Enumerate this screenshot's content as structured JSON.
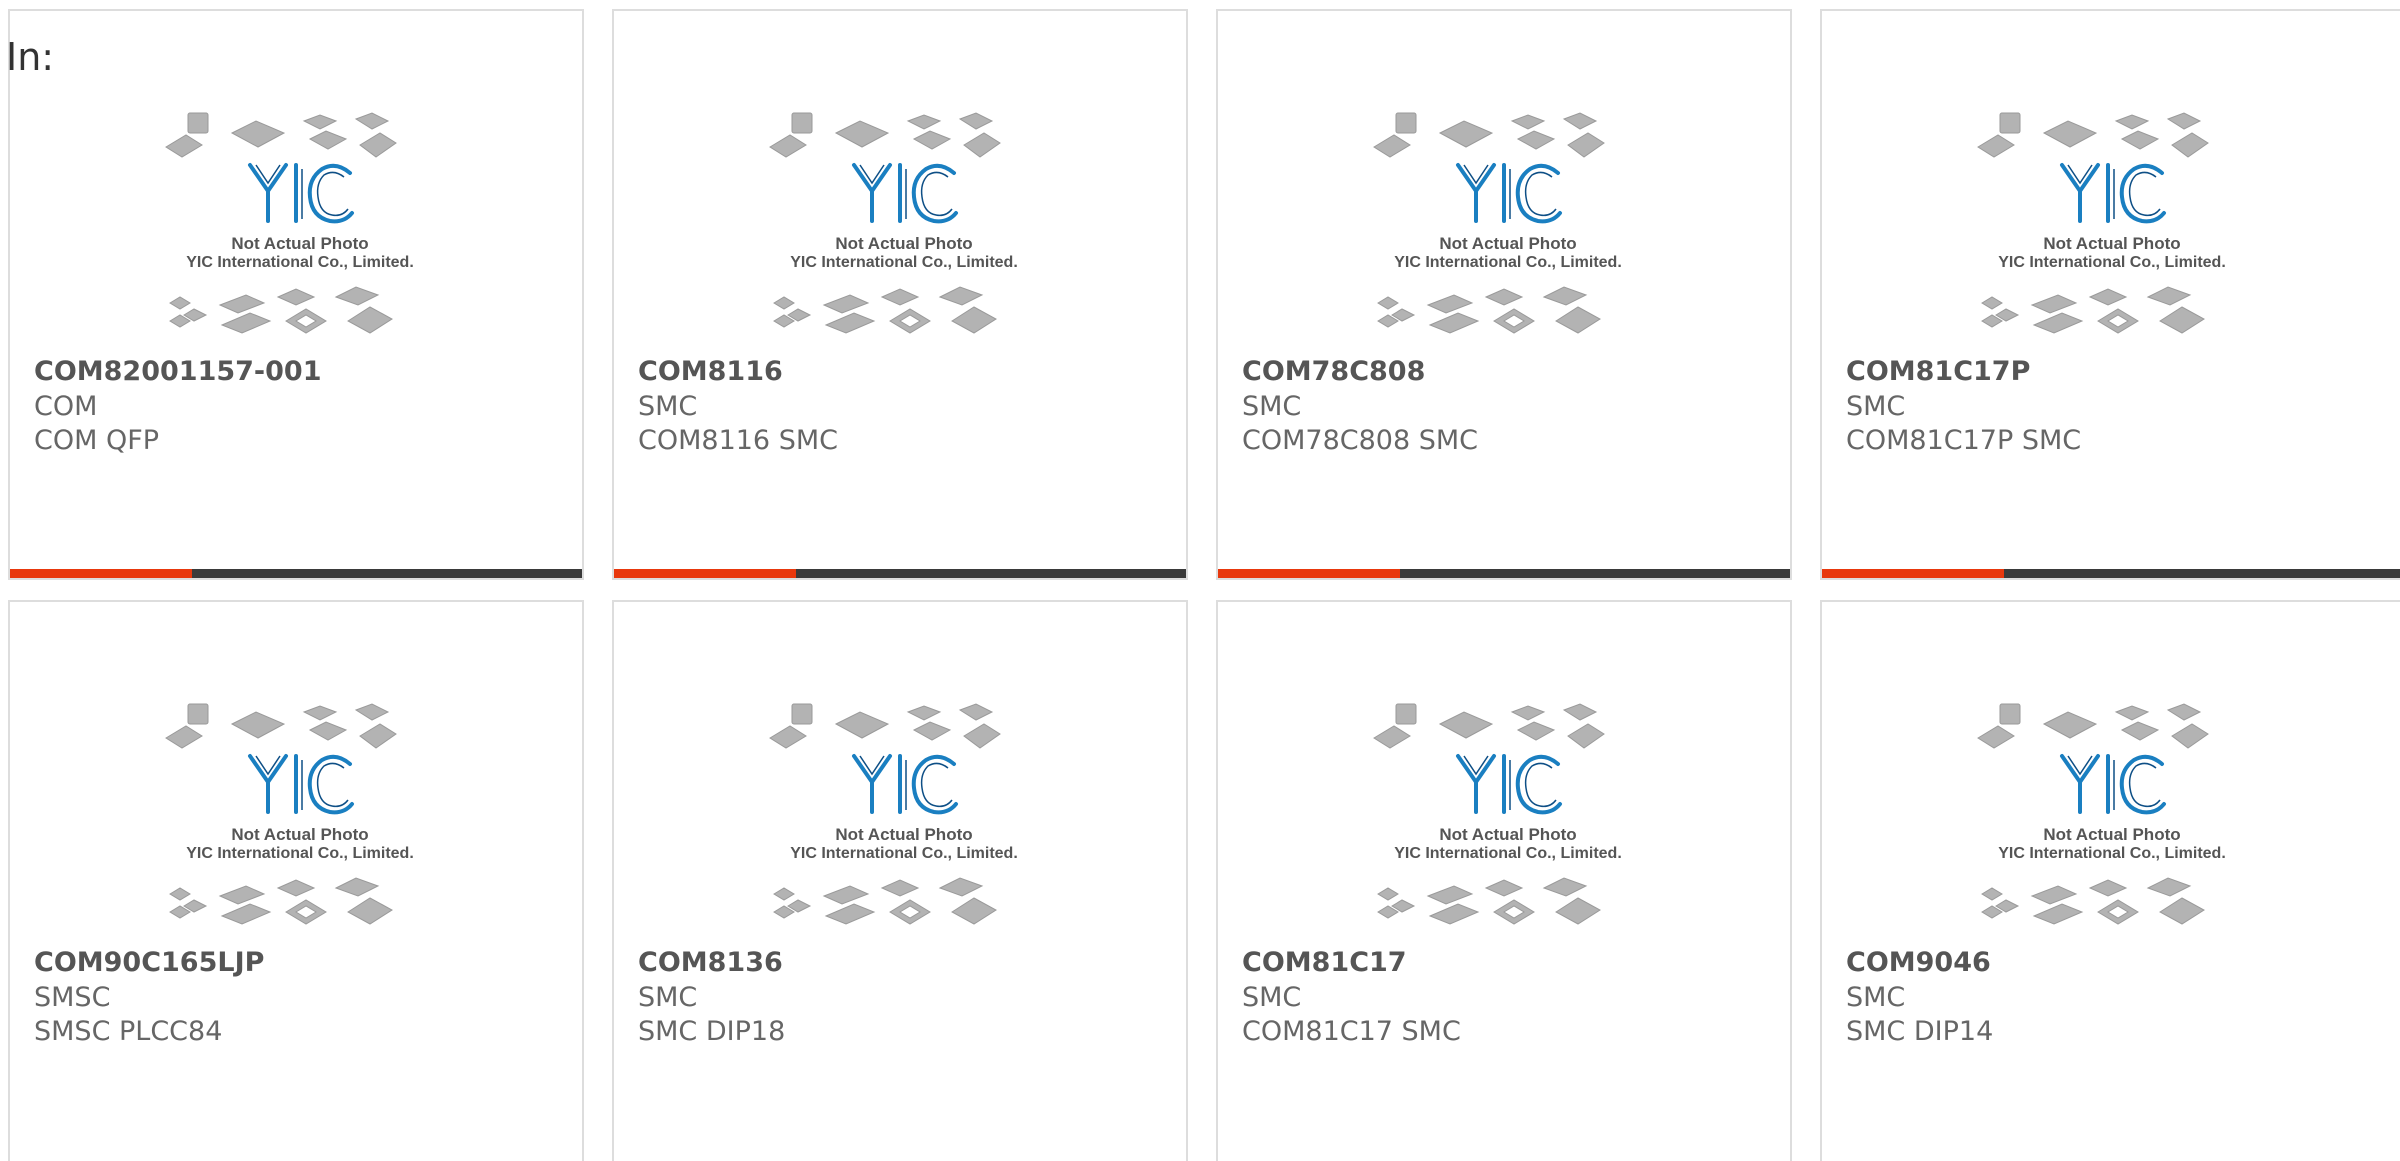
{
  "heading": "In:",
  "colors": {
    "accent": "#e8380d",
    "bar": "#3a3a3a",
    "logo_blue": "#1a7fc1",
    "chip_gray": "#b3b3b3"
  },
  "placeholder": {
    "line1": "Not Actual Photo",
    "line2": "YIC International Co., Limited.",
    "logo": "YIC",
    "icon": "chip-placeholder-icon"
  },
  "products": [
    {
      "part": "COM82001157-001",
      "manufacturer": "COM",
      "description": "COM QFP"
    },
    {
      "part": "COM8116",
      "manufacturer": "SMC",
      "description": "COM8116 SMC"
    },
    {
      "part": "COM78C808",
      "manufacturer": "SMC",
      "description": "COM78C808 SMC"
    },
    {
      "part": "COM81C17P",
      "manufacturer": "SMC",
      "description": "COM81C17P SMC"
    },
    {
      "part": "COM90C165LJP",
      "manufacturer": "SMSC",
      "description": "SMSC PLCC84"
    },
    {
      "part": "COM8136",
      "manufacturer": "SMC",
      "description": "SMC DIP18"
    },
    {
      "part": "COM81C17",
      "manufacturer": "SMC",
      "description": "COM81C17 SMC"
    },
    {
      "part": "COM9046",
      "manufacturer": "SMC",
      "description": "SMC DIP14"
    }
  ]
}
